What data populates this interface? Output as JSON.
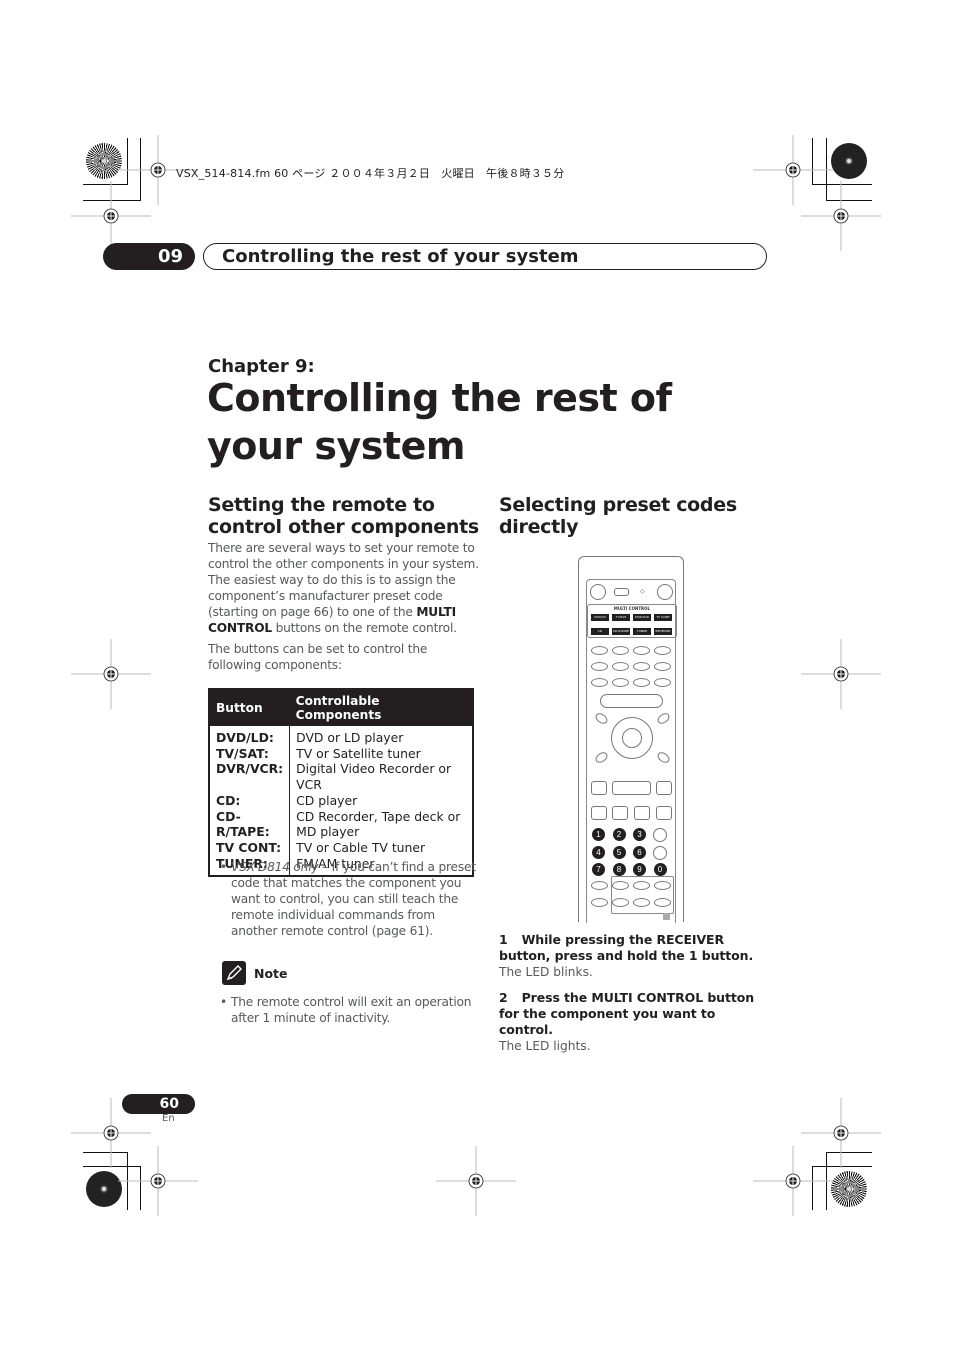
{
  "slug": "VSX_514-814.fm  60 ページ  ２００４年３月２日　火曜日　午後８時３５分",
  "header": {
    "chapter_number": "09",
    "chapter_title": "Controlling the rest of your system"
  },
  "chapter": {
    "label": "Chapter 9:",
    "title": "Controlling the rest of your system"
  },
  "left_section": {
    "heading": "Setting the remote to control other components",
    "para1_parts": {
      "pre": "There are several ways to set your remote to control the other components in your system. The easiest way to do this is to assign the component’s manufacturer preset code (starting on page 66) to one of the ",
      "bold": "MULTI CONTROL",
      "post": " buttons on the remote control."
    },
    "para2": "The buttons can be set to control the following components:",
    "table": {
      "headers": [
        "Button",
        "Controllable Components"
      ],
      "rows": [
        {
          "button": "DVD/LD:",
          "component": "DVD or LD player"
        },
        {
          "button": "TV/SAT:",
          "component": "TV or Satellite tuner"
        },
        {
          "button": "DVR/VCR:",
          "component": "Digital Video Recorder or VCR"
        },
        {
          "button": "CD:",
          "component": "CD player"
        },
        {
          "button": "CD-R/TAPE:",
          "component": "CD Recorder, Tape deck or MD player"
        },
        {
          "button": "TV CONT:",
          "component": "TV or Cable TV tuner"
        },
        {
          "button": "TUNER:",
          "component": "FM/AM tuner"
        }
      ]
    },
    "bullet": {
      "italic": "VSX-D814 only",
      "text": " – If you can’t find a preset code that matches the component you want to control, you can still teach the remote individual commands from another remote control (page 61)."
    },
    "note": {
      "label": "Note",
      "icon": "pencil-note-icon",
      "bullet": "The remote control will exit an operation after 1 minute of inactivity."
    }
  },
  "right_section": {
    "heading": "Selecting preset codes directly",
    "remote": {
      "multi_control_label": "MULTI CONTROL",
      "multi_buttons": [
        "DVD/LD",
        "TV/SAT",
        "DVR/VCR",
        "TV CONT",
        "CD",
        "CD-R/TAPE",
        "TUNER",
        "RECEIVER"
      ],
      "number_buttons": [
        "1",
        "2",
        "3",
        "4",
        "5",
        "6",
        "7",
        "8",
        "9",
        "0"
      ]
    },
    "steps": [
      {
        "number": "1",
        "instruction": "While pressing the RECEIVER button, press and hold the 1 button.",
        "result": "The LED blinks."
      },
      {
        "number": "2",
        "instruction": "Press the MULTI CONTROL button for the component you want to control.",
        "result": "The LED lights."
      }
    ]
  },
  "footer": {
    "page_number": "60",
    "language": "En"
  }
}
